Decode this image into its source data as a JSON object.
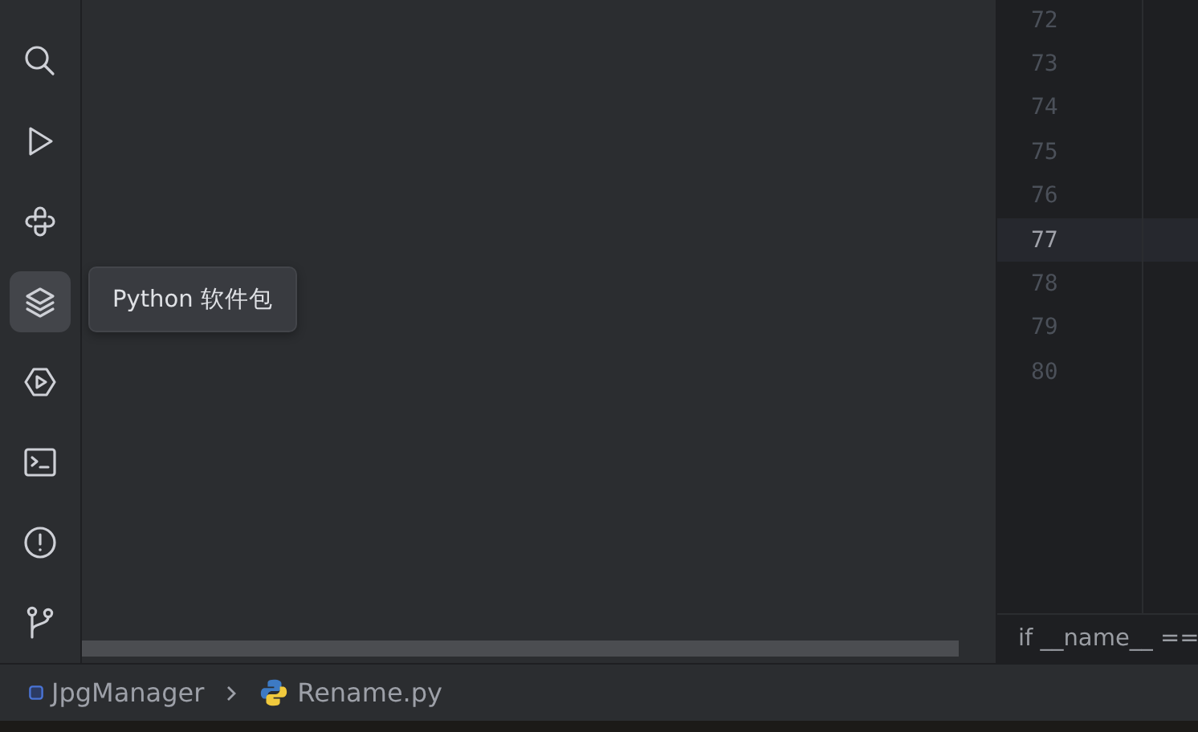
{
  "toolbar": [
    {
      "kind": "search",
      "selected": false
    },
    {
      "kind": "run",
      "selected": false
    },
    {
      "kind": "python",
      "selected": false
    },
    {
      "kind": "packages",
      "selected": true
    },
    {
      "kind": "services",
      "selected": false
    },
    {
      "kind": "terminal",
      "selected": false
    },
    {
      "kind": "problems",
      "selected": false
    },
    {
      "kind": "git",
      "selected": false
    }
  ],
  "tooltip": {
    "text": "Python 软件包"
  },
  "editor": {
    "lines": [
      {
        "number": "72",
        "current": false
      },
      {
        "number": "73",
        "current": false
      },
      {
        "number": "74",
        "current": false
      },
      {
        "number": "75",
        "current": false
      },
      {
        "number": "76",
        "current": false
      },
      {
        "number": "77",
        "current": true
      },
      {
        "number": "78",
        "current": false
      },
      {
        "number": "79",
        "current": false
      },
      {
        "number": "80",
        "current": false
      }
    ],
    "breadcrumb": "if __name__ =="
  },
  "status_bar": {
    "breadcrumbs": [
      {
        "kind": "project",
        "text": "JpgManager"
      },
      {
        "kind": "python-file",
        "text": "Rename.py"
      }
    ]
  }
}
